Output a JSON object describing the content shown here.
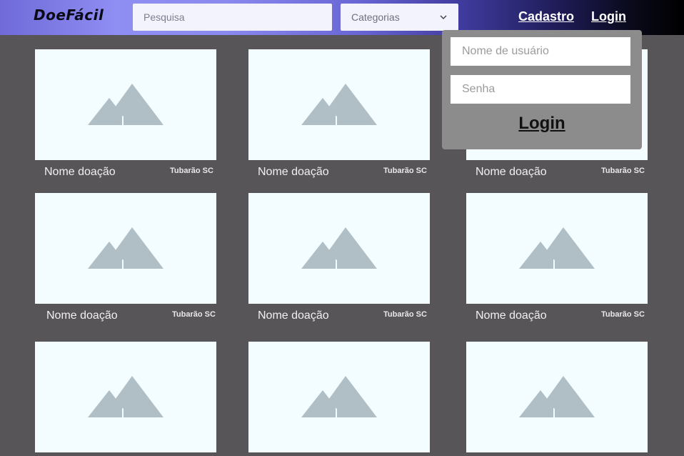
{
  "header": {
    "logo": "DoeFácil",
    "search_placeholder": "Pesquisa",
    "category_select": "Categorias",
    "links": {
      "register": "Cadastro",
      "login": "Login"
    }
  },
  "login_form": {
    "username_placeholder": "Nome de usuário",
    "password_placeholder": "Senha",
    "submit": "Login"
  },
  "donations": [
    {
      "name": "Nome doação",
      "location": "Tubarão SC"
    },
    {
      "name": "Nome doação",
      "location": "Tubarão SC"
    },
    {
      "name": "Nome doação",
      "location": "Tubarão SC"
    },
    {
      "name": "Nome doação",
      "location": "Tubarão SC"
    },
    {
      "name": "Nome doação",
      "location": "Tubarão SC"
    },
    {
      "name": "Nome doação",
      "location": "Tubarão SC"
    },
    {
      "name": "",
      "location": ""
    },
    {
      "name": "",
      "location": ""
    },
    {
      "name": "",
      "location": ""
    }
  ],
  "colors": {
    "background": "#575558",
    "image_placeholder": "#f3fcfe",
    "image_icon": "#b0bec5",
    "login_panel": "#8c8c8c"
  }
}
